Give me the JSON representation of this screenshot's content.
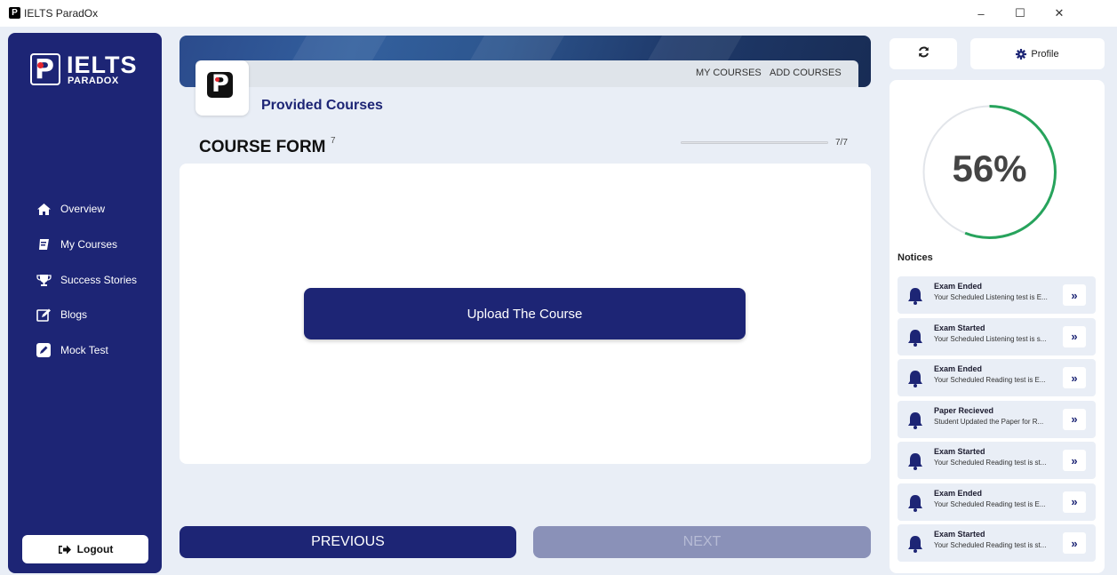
{
  "window": {
    "title": "IELTS ParadOx",
    "controls": {
      "minimize": "–",
      "maximize": "☐",
      "close": "✕"
    }
  },
  "sidebar": {
    "brand_title": "IELTS",
    "brand_subtitle": "PARADOX",
    "items": [
      {
        "label": "Overview",
        "icon": "home-icon"
      },
      {
        "label": "My Courses",
        "icon": "book-icon"
      },
      {
        "label": "Success Stories",
        "icon": "trophy-icon"
      },
      {
        "label": "Blogs",
        "icon": "edit-icon"
      },
      {
        "label": "Mock Test",
        "icon": "pencil-icon"
      }
    ],
    "logout_label": "Logout"
  },
  "header": {
    "tabs": [
      "MY COURSES",
      "ADD COURSES"
    ],
    "section_title": "Provided Courses"
  },
  "form": {
    "title": "COURSE FORM",
    "superscript": "7",
    "progress_label": "7/7",
    "progress_fraction": 1.0,
    "upload_label": "Upload The Course",
    "previous_label": "PREVIOUS",
    "next_label": "NEXT"
  },
  "right": {
    "profile_label": "Profile",
    "progress_percent": 56,
    "progress_text": "56%",
    "notices_title": "Notices",
    "notices": [
      {
        "title": "Exam Ended",
        "text": "Your Scheduled Listening test is E..."
      },
      {
        "title": "Exam Started",
        "text": "Your Scheduled Listening test is s..."
      },
      {
        "title": "Exam Ended",
        "text": "Your Scheduled Reading test is E..."
      },
      {
        "title": "Paper Recieved",
        "text": "Student Updated the Paper for R..."
      },
      {
        "title": "Exam Started",
        "text": "Your Scheduled Reading test is st..."
      },
      {
        "title": "Exam Ended",
        "text": "Your Scheduled Reading test is E..."
      },
      {
        "title": "Exam Started",
        "text": "Your Scheduled Reading test is st..."
      }
    ],
    "notice_action": "»"
  },
  "colors": {
    "navy": "#1d2575",
    "gauge_green": "#27a35c",
    "disabled": "#8a91b8"
  }
}
